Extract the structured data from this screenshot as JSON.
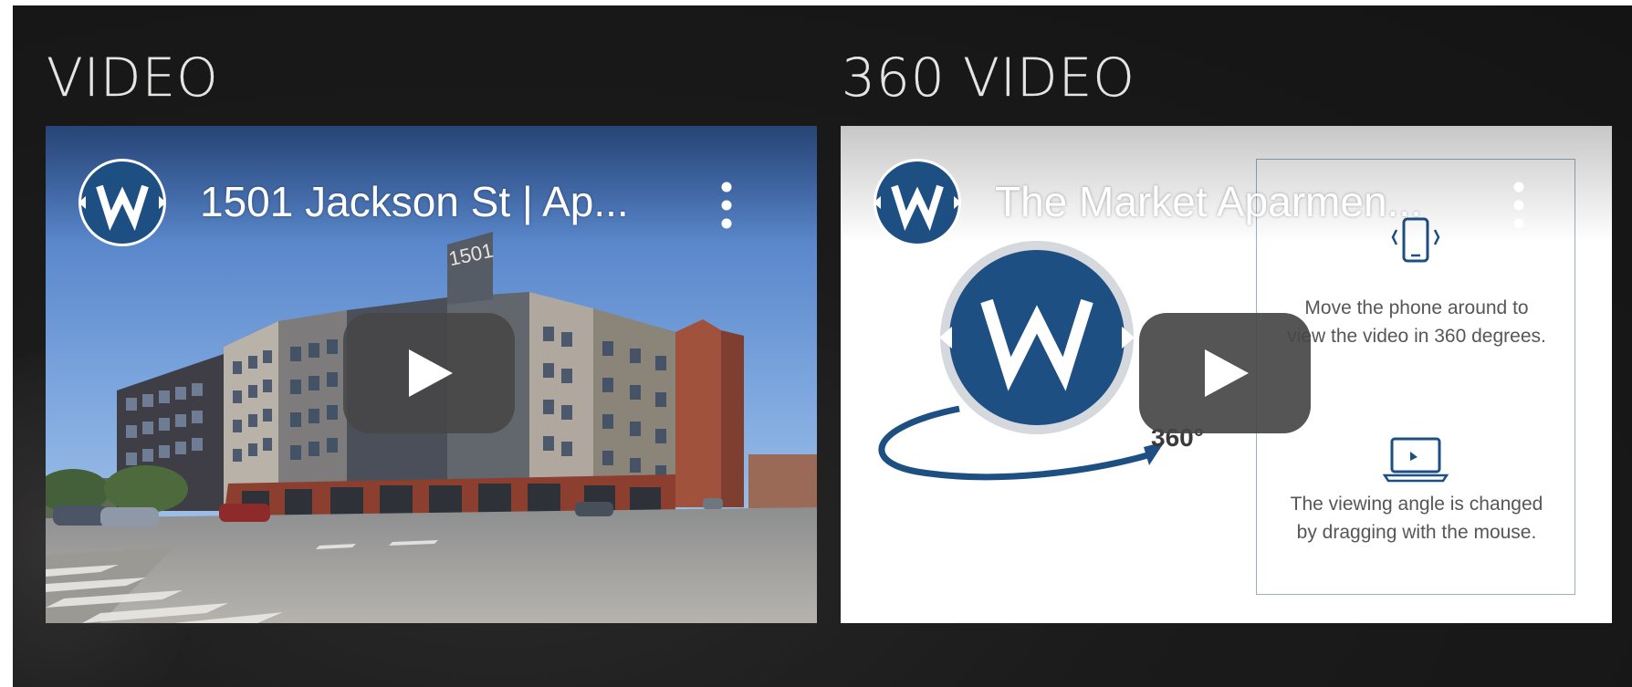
{
  "sections": {
    "video": {
      "heading": "VIDEO",
      "player": {
        "title": "1501 Jackson St | Ap...",
        "channel_icon": "w-logo-icon",
        "menu_icon": "more-vert-icon",
        "play_icon": "play-button-icon",
        "building_sign": "1501"
      }
    },
    "video360": {
      "heading": "360 VIDEO",
      "player": {
        "title": "The Market Aparmen...",
        "channel_icon": "w-logo-icon",
        "menu_icon": "more-vert-icon",
        "play_icon": "play-button-icon",
        "badge": "360°",
        "guide": {
          "phone_icon": "phone-rotate-icon",
          "phone_text": "Move the phone around to view the video in 360 degrees.",
          "laptop_icon": "laptop-icon",
          "mouse_text": "The viewing angle is changed by dragging with the mouse."
        }
      }
    }
  },
  "colors": {
    "page_background": "#181818",
    "brand_blue": "#1d4f83",
    "play_button": "#474747",
    "heading_text": "#e6e4e2"
  }
}
